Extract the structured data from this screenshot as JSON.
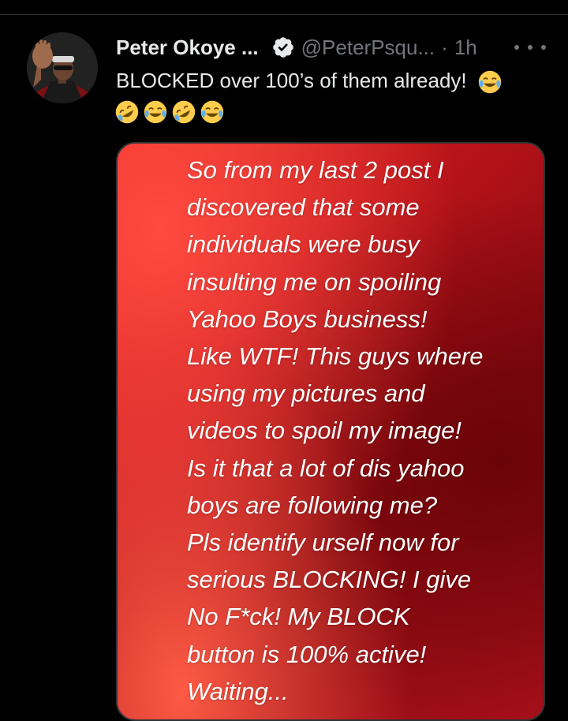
{
  "tweet": {
    "author": {
      "display_name": "Peter Okoye ...",
      "handle": "@PeterPsqu...",
      "verified": true,
      "avatar": "avatar-photo"
    },
    "separator": "·",
    "timestamp": "1h",
    "text": "BLOCKED over 100’s of them already!",
    "text_trailing_emoji": "face-with-tears-of-joy",
    "emoji_line": [
      "rolling-on-the-floor-laughing",
      "face-with-tears-of-joy",
      "rolling-on-the-floor-laughing",
      "face-with-tears-of-joy"
    ],
    "more_icon": "ellipsis-icon",
    "media": {
      "type": "text-image",
      "text": "So from my last 2 post I\ndiscovered that some\nindividuals were busy\ninsulting me on spoiling\nYahoo Boys business!\nLike WTF! This guys where\nusing my pictures and\nvideos to spoil my image!\nIs it that a lot of dis yahoo\nboys are following me?\nPls identify urself now for\nserious BLOCKING! I give\nNo F*ck! My BLOCK\nbutton is 100% active!\nWaiting...",
      "background_color": "#b8131a"
    }
  },
  "colors": {
    "background": "#000000",
    "primary_text": "#e7e9ea",
    "secondary_text": "#71767b",
    "divider": "#2f3336",
    "verified_badge": "#e7e9ea"
  }
}
